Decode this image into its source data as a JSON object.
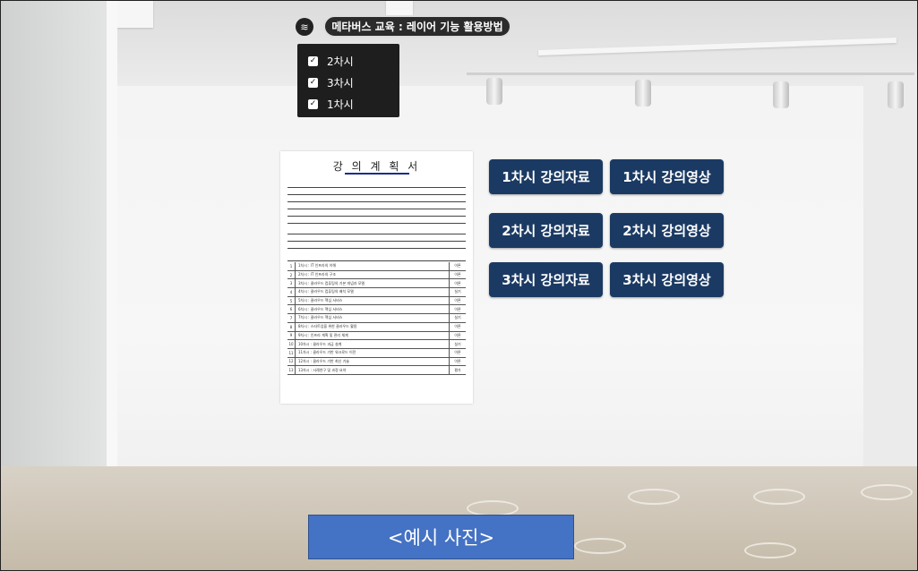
{
  "header": {
    "title": "메타버스 교육 : 레이어 기능 활용방법",
    "layers_icon": "layers-icon"
  },
  "layers": [
    {
      "label": "2차시",
      "checked": true
    },
    {
      "label": "3차시",
      "checked": true
    },
    {
      "label": "1차시",
      "checked": true
    }
  ],
  "document": {
    "title": "강 의 계 획 서",
    "items": [
      "1차시 : IT 인프라의 이해",
      "2차시 : IT 인프라의 구조",
      "3차시 : 클라우드 컴퓨팅의 기본 개념과 모델",
      "4차시 : 클라우드 컴퓨팅의 배치 모델",
      "5차시 : 클라우드 핵심 서비스",
      "6차시 : 클라우드 핵심 서비스",
      "7차시 : 클라우드 핵심 서비스",
      "8차시 : 스타트업을 위한 클라우드 활용",
      "9차시 : 인프라 계획 및 관리 체계",
      "10차시 : 클라우드 과금 설계",
      "11차시 : 클라우드 기반 워크로드 이전",
      "12차시 : 클라우드 기반 최신 기술",
      "13차시 : 사례연구 및 과정 요약"
    ]
  },
  "buttons": [
    {
      "label": "1차시 강의자료"
    },
    {
      "label": "1차시 강의영상"
    },
    {
      "label": "2차시 강의자료"
    },
    {
      "label": "2차시 강의영상"
    },
    {
      "label": "3차시 강의자료"
    },
    {
      "label": "3차시 강의영상"
    }
  ],
  "caption": "<예시 사진>",
  "colors": {
    "button_bg": "#1b3a63",
    "caption_bg": "#4472c4",
    "panel_bg": "#1e1e1e"
  }
}
